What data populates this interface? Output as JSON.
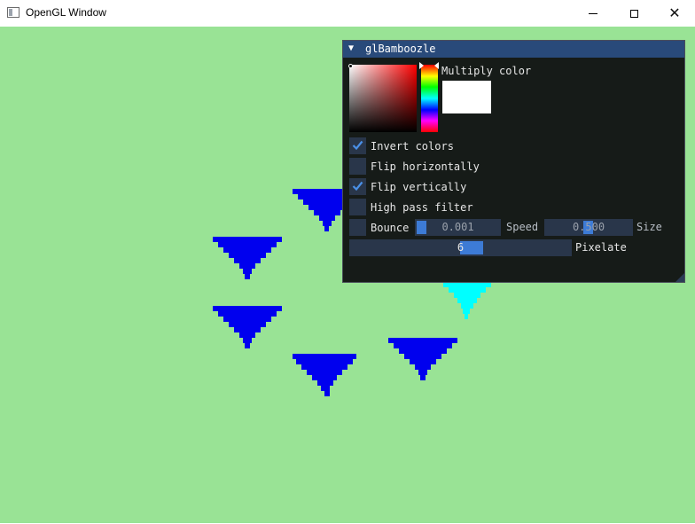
{
  "window": {
    "title": "OpenGL Window",
    "controls": {
      "minimize": "minimize",
      "maximize": "maximize",
      "close": "✕"
    }
  },
  "scene": {
    "background_color": "#99e395",
    "shapes": [
      {
        "name": "triangle",
        "color": "#0000ee"
      },
      {
        "name": "triangle",
        "color": "#0000ee"
      },
      {
        "name": "triangle",
        "color": "#0000ee"
      },
      {
        "name": "triangle",
        "color": "#0000ee"
      },
      {
        "name": "triangle",
        "color": "#0000ee"
      },
      {
        "name": "triangle",
        "color": "#00ffff"
      }
    ]
  },
  "panel": {
    "title": "glBamboozle",
    "collapse_icon": "▼",
    "multiply_color_label": "Multiply color",
    "multiply_color_value": "#ffffff",
    "checkboxes": [
      {
        "label": "Invert colors",
        "checked": true
      },
      {
        "label": "Flip horizontally",
        "checked": false
      },
      {
        "label": "Flip vertically",
        "checked": true
      },
      {
        "label": "High pass filter",
        "checked": false
      },
      {
        "label": "Bounce",
        "checked": false
      }
    ],
    "speed": {
      "value": "0.001",
      "label": "Speed"
    },
    "size": {
      "value": "0.500",
      "label": "Size"
    },
    "pixelate": {
      "value": "6",
      "label": "Pixelate"
    }
  }
}
